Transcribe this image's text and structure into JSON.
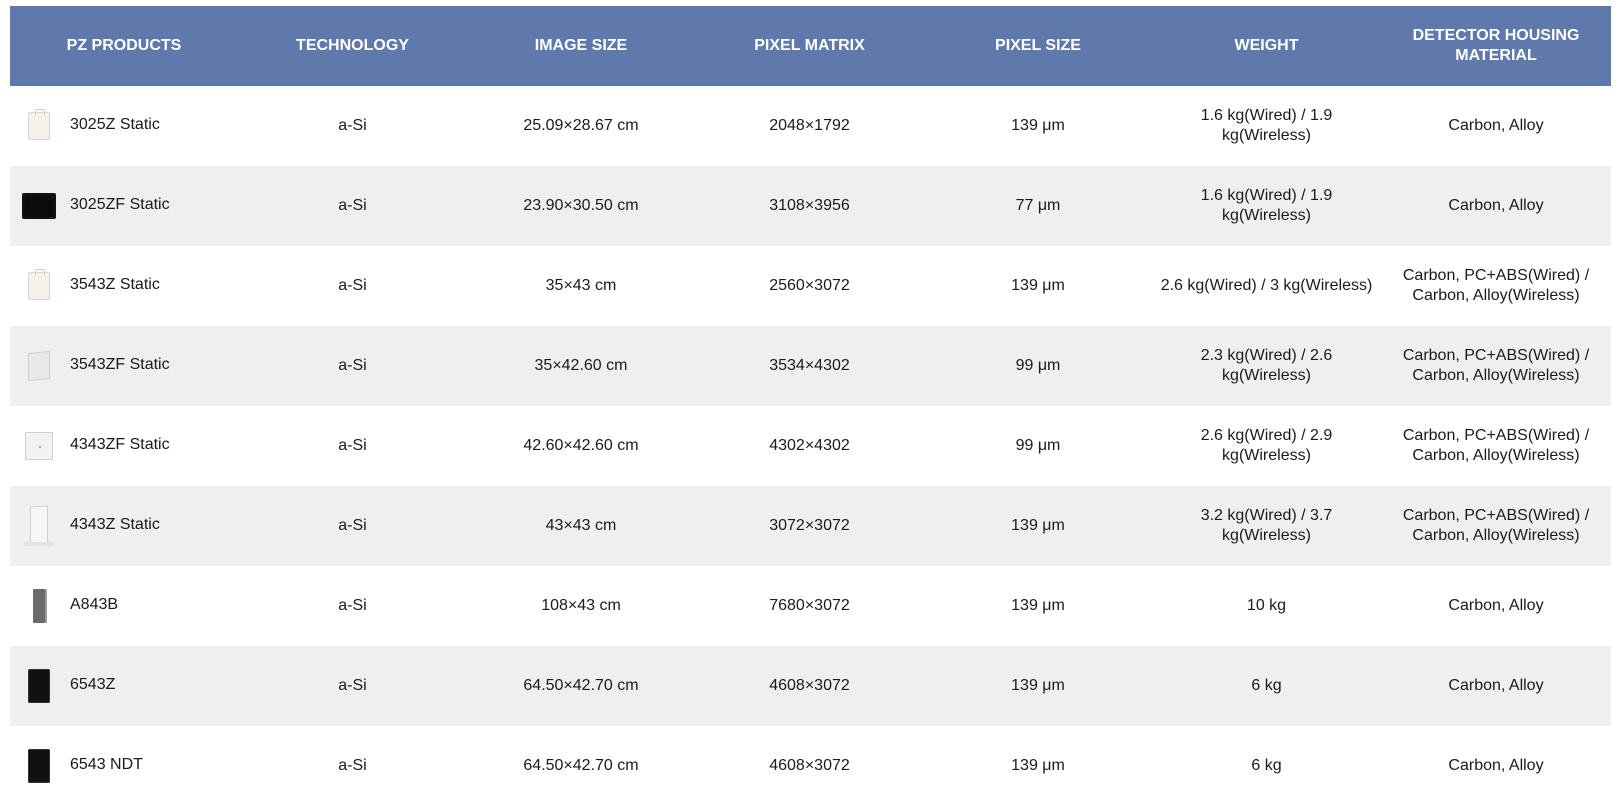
{
  "columns": [
    "PZ PRODUCTS",
    "TECHNOLOGY",
    "IMAGE SIZE",
    "PIXEL MATRIX",
    "PIXEL SIZE",
    "WEIGHT",
    "DETECTOR HOUSING MATERIAL"
  ],
  "rows": [
    {
      "product": "3025Z Static",
      "thumb_icon": "white-detector-icon",
      "technology": "a-Si",
      "image_size": "25.09×28.67 cm",
      "pixel_matrix": "2048×1792",
      "pixel_size": "139 μm",
      "weight": "1.6 kg(Wired) / 1.9 kg(Wireless)",
      "housing": "Carbon, Alloy"
    },
    {
      "product": "3025ZF Static",
      "thumb_icon": "black-detector-icon",
      "technology": "a-Si",
      "image_size": "23.90×30.50 cm",
      "pixel_matrix": "3108×3956",
      "pixel_size": "77 μm",
      "weight": "1.6 kg(Wired) / 1.9 kg(Wireless)",
      "housing": "Carbon, Alloy"
    },
    {
      "product": "3543Z Static",
      "thumb_icon": "white-detector-icon",
      "technology": "a-Si",
      "image_size": "35×43 cm",
      "pixel_matrix": "2560×3072",
      "pixel_size": "139 μm",
      "weight": "2.6 kg(Wired) / 3 kg(Wireless)",
      "housing": "Carbon, PC+ABS(Wired) / Carbon, Alloy(Wireless)"
    },
    {
      "product": "3543ZF Static",
      "thumb_icon": "grey-sheet-detector-icon",
      "technology": "a-Si",
      "image_size": "35×42.60 cm",
      "pixel_matrix": "3534×4302",
      "pixel_size": "99 μm",
      "weight": "2.3 kg(Wired) / 2.6 kg(Wireless)",
      "housing": "Carbon, PC+ABS(Wired) / Carbon, Alloy(Wireless)"
    },
    {
      "product": "4343ZF Static",
      "thumb_icon": "square-detector-icon",
      "technology": "a-Si",
      "image_size": "42.60×42.60 cm",
      "pixel_matrix": "4302×4302",
      "pixel_size": "99 μm",
      "weight": "2.6 kg(Wired) / 2.9 kg(Wireless)",
      "housing": "Carbon, PC+ABS(Wired) / Carbon, Alloy(Wireless)"
    },
    {
      "product": "4343Z Static",
      "thumb_icon": "standing-detector-icon",
      "technology": "a-Si",
      "image_size": "43×43 cm",
      "pixel_matrix": "3072×3072",
      "pixel_size": "139 μm",
      "weight": "3.2 kg(Wired) / 3.7 kg(Wireless)",
      "housing": "Carbon, PC+ABS(Wired) / Carbon, Alloy(Wireless)"
    },
    {
      "product": "A843B",
      "thumb_icon": "grey-panel-icon",
      "technology": "a-Si",
      "image_size": "108×43 cm",
      "pixel_matrix": "7680×3072",
      "pixel_size": "139 μm",
      "weight": "10 kg",
      "housing": "Carbon, Alloy"
    },
    {
      "product": "6543Z",
      "thumb_icon": "black-panel-icon",
      "technology": "a-Si",
      "image_size": "64.50×42.70 cm",
      "pixel_matrix": "4608×3072",
      "pixel_size": "139 μm",
      "weight": "6 kg",
      "housing": "Carbon, Alloy"
    },
    {
      "product": "6543 NDT",
      "thumb_icon": "black-panel-icon",
      "technology": "a-Si",
      "image_size": "64.50×42.70 cm",
      "pixel_matrix": "4608×3072",
      "pixel_size": "139 μm",
      "weight": "6 kg",
      "housing": "Carbon, Alloy"
    }
  ],
  "colors": {
    "header_bg": "#5f79ac",
    "header_text": "#ffffff",
    "row_alt_bg": "#efefef",
    "row_bg": "#ffffff"
  }
}
